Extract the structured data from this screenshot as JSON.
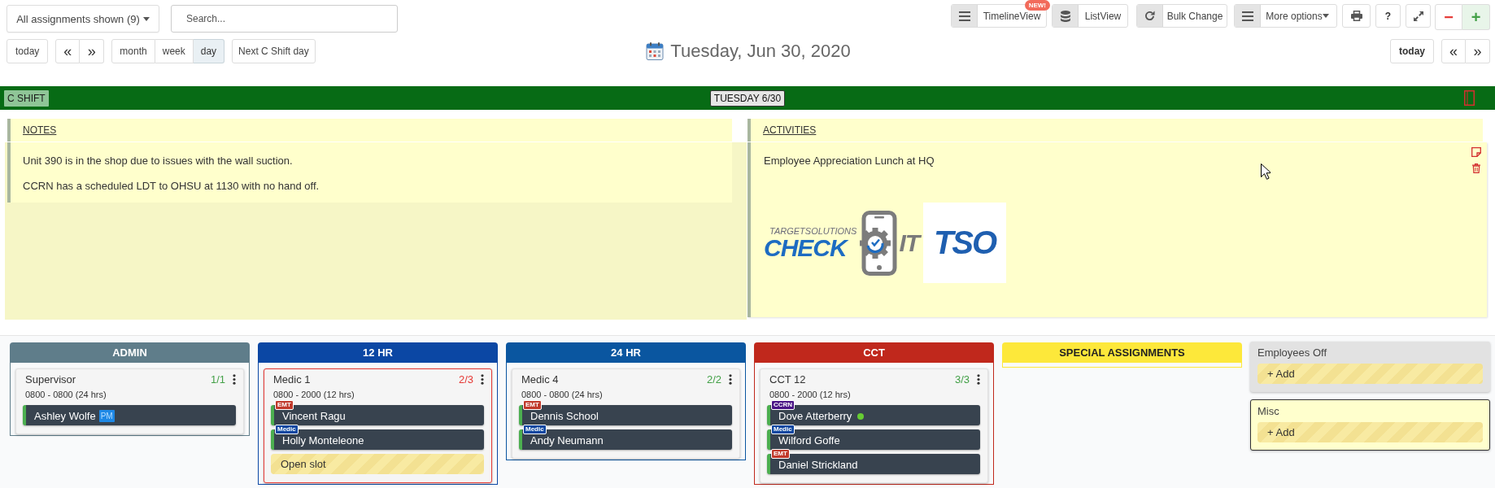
{
  "toolbar": {
    "filter": {
      "label": "All assignments shown (9)"
    },
    "search": {
      "placeholder": "Search..."
    },
    "views": [
      {
        "kind": "timeline",
        "label": "TimelineView",
        "badge": "NEW!"
      },
      {
        "kind": "list",
        "label": "ListView"
      },
      {
        "kind": "bulk",
        "label": "Bulk Change"
      },
      {
        "kind": "more",
        "label": "More options"
      }
    ],
    "tools": [
      {
        "kind": "print"
      },
      {
        "kind": "help",
        "label": "?"
      },
      {
        "kind": "expand"
      }
    ],
    "zoom": [
      {
        "kind": "minus",
        "label": "−"
      },
      {
        "kind": "plus",
        "label": "+"
      }
    ]
  },
  "navigation": {
    "today": "today",
    "prev": "«",
    "next": "»",
    "ranges": [
      {
        "label": "month",
        "selected": false
      },
      {
        "label": "week",
        "selected": false
      },
      {
        "label": "day",
        "selected": true
      }
    ],
    "next_shift": "Next C Shift day"
  },
  "date_title": "Tuesday, Jun 30, 2020",
  "navigation_right": {
    "today": "today",
    "prev": "«",
    "next": "»"
  },
  "shift_bar": {
    "shift": "C SHIFT",
    "date": "TUESDAY 6/30"
  },
  "notes": {
    "title": "NOTES",
    "items": [
      "Unit 390 is in the shop due to issues with the wall suction.",
      "CCRN has a scheduled LDT to OHSU at 1130 with no hand off."
    ]
  },
  "activities": {
    "title": "ACTIVITIES",
    "items": [
      "Employee Appreciation Lunch at HQ"
    ],
    "logo": {
      "tagline": "TARGETSOLUTIONS",
      "word_1": "CHECK",
      "word_2": "IT",
      "mark": "TSO"
    }
  },
  "columns": [
    {
      "title": "ADMIN",
      "color": "#5f7d8a",
      "assignments": [
        {
          "name": "Supervisor",
          "hours": "0800 - 0800 (24 hrs)",
          "count": "1/1",
          "full": true,
          "slots": [
            {
              "kind": "person",
              "name": "Ashley Wolfe",
              "tag": "PM",
              "online": false
            }
          ]
        }
      ]
    },
    {
      "title": "12 HR",
      "color": "#0b47a4",
      "assignments": [
        {
          "name": "Medic 1",
          "hours": "0800 - 2000 (12 hrs)",
          "count": "2/3",
          "full": false,
          "slots": [
            {
              "kind": "person",
              "name": "Vincent Ragu",
              "role": {
                "label": "EMT",
                "color": "#c0392b"
              },
              "online": false
            },
            {
              "kind": "person",
              "name": "Holly Monteleone",
              "role": {
                "label": "Medic",
                "color": "#0d47a1"
              },
              "online": false
            },
            {
              "kind": "open",
              "label": "Open slot"
            }
          ]
        }
      ]
    },
    {
      "title": "24 HR",
      "color": "#0a56a0",
      "assignments": [
        {
          "name": "Medic 4",
          "hours": "0800 - 0800 (24 hrs)",
          "count": "2/2",
          "full": true,
          "slots": [
            {
              "kind": "person",
              "name": "Dennis School",
              "role": {
                "label": "EMT",
                "color": "#c0392b"
              },
              "online": false
            },
            {
              "kind": "person",
              "name": "Andy Neumann",
              "role": {
                "label": "Medic",
                "color": "#0d47a1"
              },
              "online": false
            }
          ]
        }
      ]
    },
    {
      "title": "CCT",
      "color": "#c0281c",
      "assignments": [
        {
          "name": "CCT 12",
          "hours": "0800 - 2000 (12 hrs)",
          "count": "3/3",
          "full": true,
          "slots": [
            {
              "kind": "person",
              "name": "Dove Atterberry",
              "role": {
                "label": "CCRN",
                "color": "#4a1486"
              },
              "online": true
            },
            {
              "kind": "person",
              "name": "Wilford Goffe",
              "role": {
                "label": "Medic",
                "color": "#0d47a1"
              },
              "online": false
            },
            {
              "kind": "person",
              "name": "Daniel Strickland",
              "role": {
                "label": "EMT",
                "color": "#c0392b"
              },
              "online": false
            }
          ]
        }
      ]
    },
    {
      "title": "SPECIAL ASSIGNMENTS",
      "color": "#fde83a"
    }
  ],
  "side_panels": [
    {
      "kind": "off",
      "title": "Employees Off",
      "action": "+ Add"
    },
    {
      "kind": "misc",
      "title": "Misc",
      "action": "+ Add"
    }
  ]
}
